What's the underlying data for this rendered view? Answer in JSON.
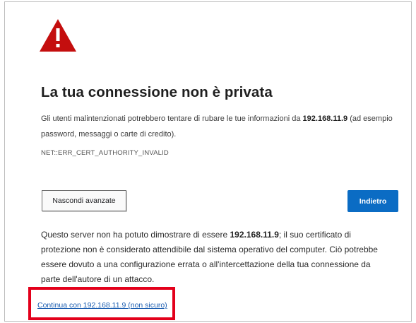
{
  "title": "La tua connessione non è privata",
  "description": {
    "before": "Gli utenti malintenzionati potrebbero tentare di rubare le tue informazioni da ",
    "host": "192.168.11.9",
    "after": " (ad esempio password, messaggi o carte di credito)."
  },
  "error_code": "NET::ERR_CERT_AUTHORITY_INVALID",
  "buttons": {
    "advanced_label": "Nascondi avanzate",
    "back_label": "Indietro"
  },
  "details": {
    "before": "Questo server non ha potuto dimostrare di essere ",
    "host": "192.168.11.9",
    "after": "; il suo certificato di protezione non è considerato attendibile dal sistema operativo del computer. Ciò potrebbe essere dovuto a una configurazione errata o all'intercettazione della tua connessione da parte dell'autore di un attacco."
  },
  "proceed_link": "Continua con 192.168.11.9 (non sicuro)",
  "colors": {
    "warning_icon": "#c40e0e",
    "primary_button": "#0b6cc4",
    "highlight_box": "#e3001b",
    "link": "#1a5cb0"
  },
  "icons": {
    "warning": "warning-triangle-icon"
  }
}
